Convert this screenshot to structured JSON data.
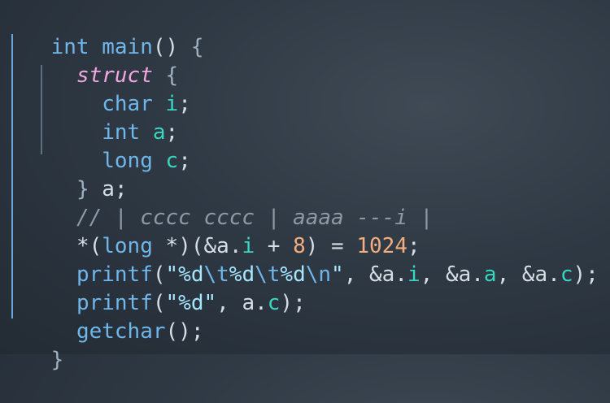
{
  "code": {
    "lines": [
      [
        {
          "text": "int",
          "cls": "kw"
        },
        {
          "text": " ",
          "cls": "punct"
        },
        {
          "text": "main",
          "cls": "fn"
        },
        {
          "text": "()",
          "cls": "punct"
        },
        {
          "text": " ",
          "cls": "punct"
        },
        {
          "text": "{",
          "cls": "brace"
        }
      ],
      [
        {
          "text": "  ",
          "cls": "punct"
        },
        {
          "text": "struct",
          "cls": "struct"
        },
        {
          "text": " ",
          "cls": "punct"
        },
        {
          "text": "{",
          "cls": "brace"
        }
      ],
      [
        {
          "text": "    ",
          "cls": "punct"
        },
        {
          "text": "char",
          "cls": "kw"
        },
        {
          "text": " ",
          "cls": "punct"
        },
        {
          "text": "i",
          "cls": "var"
        },
        {
          "text": ";",
          "cls": "punct"
        }
      ],
      [
        {
          "text": "    ",
          "cls": "punct"
        },
        {
          "text": "int",
          "cls": "kw"
        },
        {
          "text": " ",
          "cls": "punct"
        },
        {
          "text": "a",
          "cls": "var"
        },
        {
          "text": ";",
          "cls": "punct"
        }
      ],
      [
        {
          "text": "    ",
          "cls": "punct"
        },
        {
          "text": "long",
          "cls": "kw"
        },
        {
          "text": " ",
          "cls": "punct"
        },
        {
          "text": "c",
          "cls": "var"
        },
        {
          "text": ";",
          "cls": "punct"
        }
      ],
      [
        {
          "text": "  ",
          "cls": "punct"
        },
        {
          "text": "}",
          "cls": "brace"
        },
        {
          "text": " ",
          "cls": "punct"
        },
        {
          "text": "a",
          "cls": "ref"
        },
        {
          "text": ";",
          "cls": "punct"
        }
      ],
      [
        {
          "text": "  ",
          "cls": "punct"
        },
        {
          "text": "// | cccc cccc | aaaa ---i |",
          "cls": "comment"
        }
      ],
      [
        {
          "text": "  ",
          "cls": "punct"
        },
        {
          "text": "*(",
          "cls": "op"
        },
        {
          "text": "long",
          "cls": "kw"
        },
        {
          "text": " ",
          "cls": "punct"
        },
        {
          "text": "*",
          "cls": "op"
        },
        {
          "text": ")(",
          "cls": "op"
        },
        {
          "text": "&a",
          "cls": "ref"
        },
        {
          "text": ".",
          "cls": "punct"
        },
        {
          "text": "i",
          "cls": "var"
        },
        {
          "text": " + ",
          "cls": "op"
        },
        {
          "text": "8",
          "cls": "num"
        },
        {
          "text": ") = ",
          "cls": "op"
        },
        {
          "text": "1024",
          "cls": "num"
        },
        {
          "text": ";",
          "cls": "punct"
        }
      ],
      [
        {
          "text": "  ",
          "cls": "punct"
        },
        {
          "text": "printf",
          "cls": "fn"
        },
        {
          "text": "(",
          "cls": "punct"
        },
        {
          "text": "\"%d",
          "cls": "str"
        },
        {
          "text": "\\t",
          "cls": "esc"
        },
        {
          "text": "%d",
          "cls": "str"
        },
        {
          "text": "\\t",
          "cls": "esc"
        },
        {
          "text": "%d",
          "cls": "str"
        },
        {
          "text": "\\n",
          "cls": "esc"
        },
        {
          "text": "\"",
          "cls": "str"
        },
        {
          "text": ", ",
          "cls": "punct"
        },
        {
          "text": "&a",
          "cls": "ref"
        },
        {
          "text": ".",
          "cls": "punct"
        },
        {
          "text": "i",
          "cls": "var"
        },
        {
          "text": ", ",
          "cls": "punct"
        },
        {
          "text": "&a",
          "cls": "ref"
        },
        {
          "text": ".",
          "cls": "punct"
        },
        {
          "text": "a",
          "cls": "var"
        },
        {
          "text": ", ",
          "cls": "punct"
        },
        {
          "text": "&a",
          "cls": "ref"
        },
        {
          "text": ".",
          "cls": "punct"
        },
        {
          "text": "c",
          "cls": "var"
        },
        {
          "text": ");",
          "cls": "punct"
        }
      ],
      [
        {
          "text": "  ",
          "cls": "punct"
        },
        {
          "text": "printf",
          "cls": "fn"
        },
        {
          "text": "(",
          "cls": "punct"
        },
        {
          "text": "\"%d\"",
          "cls": "str"
        },
        {
          "text": ", ",
          "cls": "punct"
        },
        {
          "text": "a",
          "cls": "ref"
        },
        {
          "text": ".",
          "cls": "punct"
        },
        {
          "text": "c",
          "cls": "var"
        },
        {
          "text": ");",
          "cls": "punct"
        }
      ],
      [
        {
          "text": "  ",
          "cls": "punct"
        },
        {
          "text": "getchar",
          "cls": "fn"
        },
        {
          "text": "();",
          "cls": "punct"
        }
      ],
      [
        {
          "text": "}",
          "cls": "brace"
        }
      ]
    ]
  }
}
